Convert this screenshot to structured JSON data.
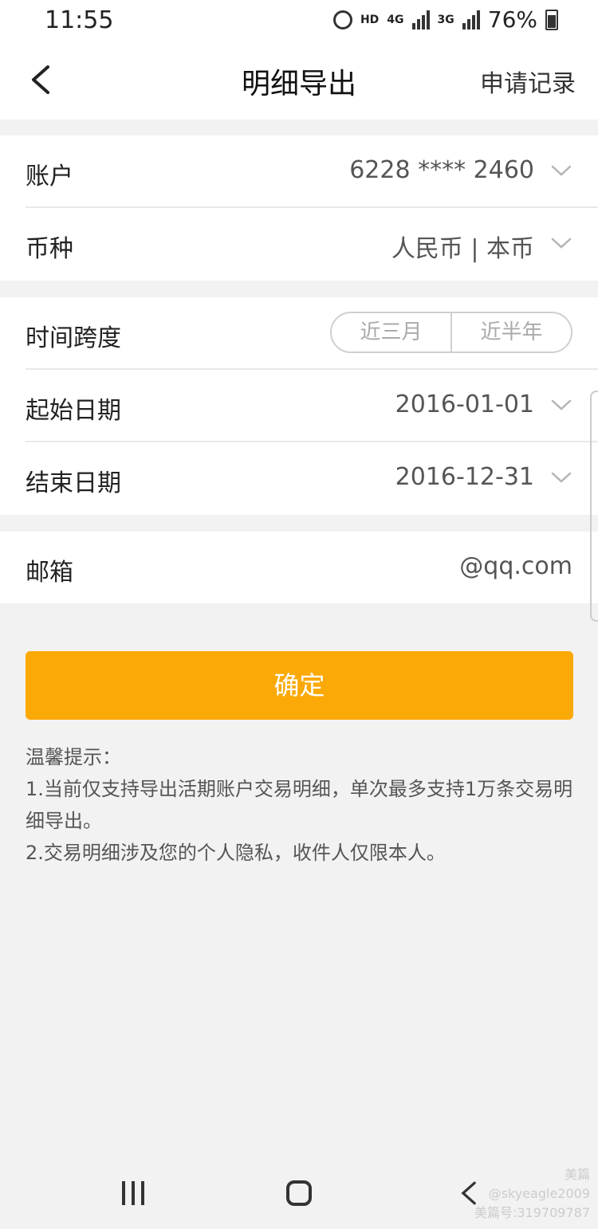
{
  "status_bar": {
    "time": "11:55",
    "hd": "HD",
    "net1": "4G",
    "net2": "3G",
    "battery": "76%"
  },
  "nav": {
    "title": "明细导出",
    "right_action": "申请记录"
  },
  "form": {
    "account": {
      "label": "账户",
      "value": "6228 **** 2460"
    },
    "currency": {
      "label": "币种",
      "value": "人民币 | 本币"
    },
    "time_span": {
      "label": "时间跨度",
      "options": [
        "近三月",
        "近半年"
      ]
    },
    "start_date": {
      "label": "起始日期",
      "value": "2016-01-01"
    },
    "end_date": {
      "label": "结束日期",
      "value": "2016-12-31"
    },
    "email": {
      "label": "邮箱",
      "value": "@qq.com"
    }
  },
  "confirm_label": "确定",
  "tips": {
    "title": "温馨提示：",
    "line1": "1.当前仅支持导出活期账户交易明细，单次最多支持1万条交易明细导出。",
    "line2": "2.交易明细涉及您的个人隐私，收件人仅限本人。"
  },
  "watermark": {
    "line1": "美篇",
    "line2": "@skyeagle2009",
    "line3": "美篇号:319709787"
  }
}
